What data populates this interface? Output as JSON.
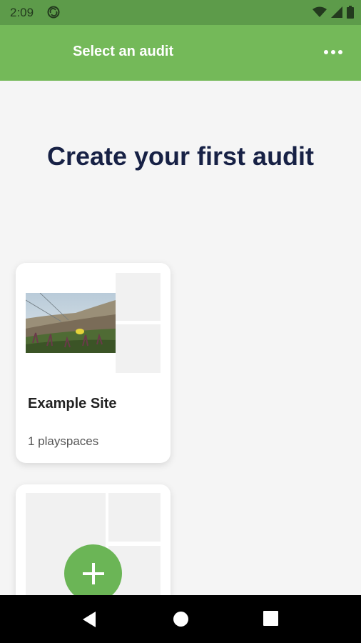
{
  "status_bar": {
    "time": "2:09"
  },
  "app_bar": {
    "title": "Select an audit"
  },
  "main": {
    "heading": "Create your first audit",
    "audits": [
      {
        "name": "Example Site",
        "count": "1 playspaces"
      }
    ]
  },
  "colors": {
    "status_bar": "#5d9b4a",
    "app_bar": "#74b959",
    "heading": "#172145",
    "fab": "#6bb556",
    "background": "#f5f5f5"
  },
  "icons": {
    "sync": "sync-icon",
    "wifi": "wifi-icon",
    "signal": "signal-icon",
    "battery": "battery-icon",
    "more": "more-horizontal-icon",
    "add": "plus-icon",
    "back": "back-triangle-icon",
    "home": "home-circle-icon",
    "recents": "recents-square-icon"
  }
}
